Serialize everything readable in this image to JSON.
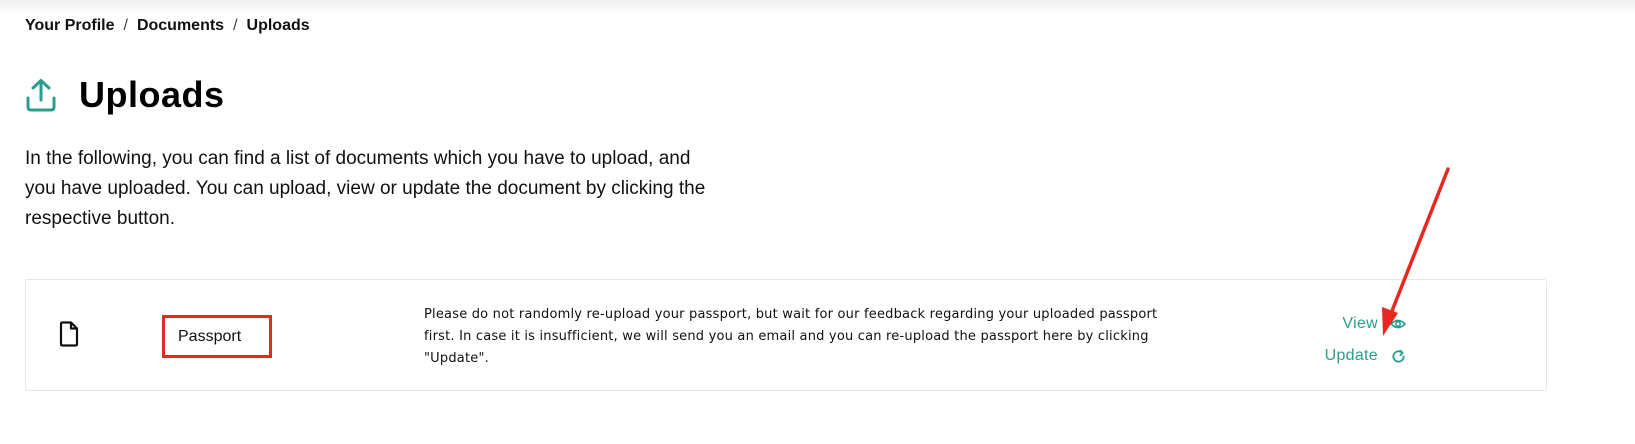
{
  "breadcrumb": {
    "items": [
      "Your Profile",
      "Documents",
      "Uploads"
    ],
    "separator": "/"
  },
  "page": {
    "title": "Uploads",
    "icon": "upload-icon",
    "intro": "In the following, you can find a list of documents which you have to upload, and you have uploaded. You can upload, view or update the document by clicking the respective button."
  },
  "documents": [
    {
      "icon": "file-icon",
      "name": "Passport",
      "description": "Please do not randomly re-upload your passport, but wait for our feedback regarding your uploaded passport first. In case it is insufficient, we will send you an email and you can re-upload the passport here by clicking \"Update\".",
      "actions": {
        "view_label": "View",
        "view_icon": "eye-icon",
        "update_label": "Update",
        "update_icon": "refresh-icon"
      }
    }
  ],
  "colors": {
    "accent": "#2a9d8f",
    "annotation": "#e8281e"
  }
}
